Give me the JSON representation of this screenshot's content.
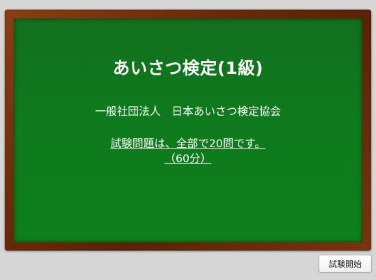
{
  "board": {
    "title": "あいさつ検定(1級)",
    "organization": "一般社団法人　日本あいさつ検定協会",
    "question_info": "試験問題は、全部で20問です。",
    "time_limit": "（60分）"
  },
  "footer": {
    "start_button_label": "試験開始"
  },
  "colors": {
    "board_green": "#0f7a1d",
    "frame_brown": "#6b2a08",
    "background": "#d6d6d6"
  }
}
